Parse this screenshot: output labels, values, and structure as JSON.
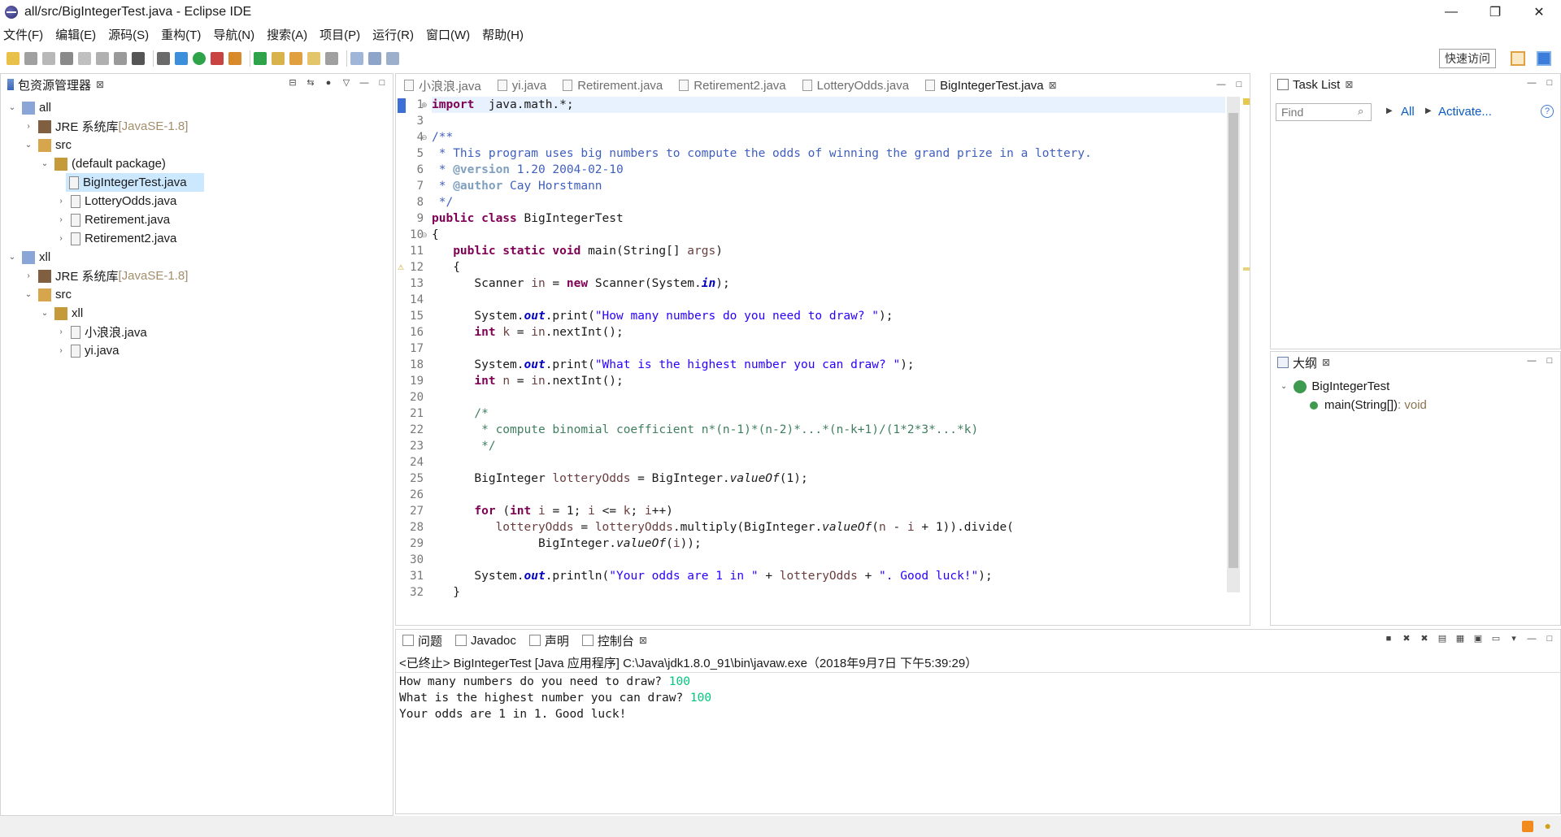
{
  "window": {
    "title": "all/src/BigIntegerTest.java - Eclipse IDE",
    "minimize": "—",
    "restore": "❐",
    "close": "✕"
  },
  "menu": [
    "文件(F)",
    "编辑(E)",
    "源码(S)",
    "重构(T)",
    "导航(N)",
    "搜索(A)",
    "项目(P)",
    "运行(R)",
    "窗口(W)",
    "帮助(H)"
  ],
  "toolbar": {
    "quick_access": "快速访问"
  },
  "package_explorer": {
    "title": "包资源管理器",
    "rows": [
      {
        "label": "all",
        "suffix": "",
        "chev": "⌄",
        "indent": 0,
        "icon": "project-icon"
      },
      {
        "label": "JRE 系统库 ",
        "suffix": "[JavaSE-1.8]",
        "chev": "›",
        "indent": 1,
        "icon": "library-icon"
      },
      {
        "label": "src",
        "suffix": "",
        "chev": "⌄",
        "indent": 1,
        "icon": "source-folder-icon"
      },
      {
        "label": "(default package)",
        "suffix": "",
        "chev": "⌄",
        "indent": 2,
        "icon": "package-icon"
      },
      {
        "label": "BigIntegerTest.java",
        "suffix": "",
        "chev": "›",
        "indent": 3,
        "icon": "java-file-icon",
        "selected": true
      },
      {
        "label": "LotteryOdds.java",
        "suffix": "",
        "chev": "›",
        "indent": 3,
        "icon": "java-file-icon"
      },
      {
        "label": "Retirement.java",
        "suffix": "",
        "chev": "›",
        "indent": 3,
        "icon": "java-file-icon"
      },
      {
        "label": "Retirement2.java",
        "suffix": "",
        "chev": "›",
        "indent": 3,
        "icon": "java-file-icon"
      },
      {
        "label": "xll",
        "suffix": "",
        "chev": "⌄",
        "indent": 0,
        "icon": "project-icon"
      },
      {
        "label": "JRE 系统库 ",
        "suffix": "[JavaSE-1.8]",
        "chev": "›",
        "indent": 1,
        "icon": "library-icon"
      },
      {
        "label": "src",
        "suffix": "",
        "chev": "⌄",
        "indent": 1,
        "icon": "source-folder-icon"
      },
      {
        "label": "xll",
        "suffix": "",
        "chev": "⌄",
        "indent": 2,
        "icon": "package-icon"
      },
      {
        "label": "小浪浪.java",
        "suffix": "",
        "chev": "›",
        "indent": 3,
        "icon": "java-file-icon"
      },
      {
        "label": "yi.java",
        "suffix": "",
        "chev": "›",
        "indent": 3,
        "icon": "java-file-icon"
      }
    ]
  },
  "editor": {
    "tabs": [
      {
        "label": "小浪浪.java",
        "active": false
      },
      {
        "label": "yi.java",
        "active": false
      },
      {
        "label": "Retirement.java",
        "active": false
      },
      {
        "label": "Retirement2.java",
        "active": false
      },
      {
        "label": "LotteryOdds.java",
        "active": false
      },
      {
        "label": "BigIntegerTest.java",
        "active": true
      }
    ],
    "line_numbers": [
      "1",
      "3",
      "4",
      "5",
      "6",
      "7",
      "8",
      "9",
      "10",
      "11",
      "12",
      "13",
      "14",
      "15",
      "16",
      "17",
      "18",
      "19",
      "20",
      "21",
      "22",
      "23",
      "24",
      "25",
      "26",
      "27",
      "28",
      "29",
      "30",
      "31",
      "32"
    ],
    "lines": [
      [
        [
          "kw",
          "import"
        ],
        [
          "",
          "  java.math.*;"
        ]
      ],
      [],
      [
        [
          "jd",
          "/**"
        ]
      ],
      [
        [
          "jd",
          " * This program uses big numbers to compute the odds of winning the grand prize in a lottery."
        ]
      ],
      [
        [
          "jd",
          " * "
        ],
        [
          "tag",
          "@version"
        ],
        [
          "jd",
          " 1.20 2004-02-10"
        ]
      ],
      [
        [
          "jd",
          " * "
        ],
        [
          "tag",
          "@author"
        ],
        [
          "jd",
          " Cay Horstmann"
        ]
      ],
      [
        [
          "jd",
          " */"
        ]
      ],
      [
        [
          "kw",
          "public class"
        ],
        [
          "",
          " BigIntegerTest"
        ]
      ],
      [
        [
          "",
          "{"
        ]
      ],
      [
        [
          "",
          "   "
        ],
        [
          "kw",
          "public static void"
        ],
        [
          "",
          " main(String[] "
        ],
        [
          "var",
          "args"
        ],
        [
          "",
          ")"
        ]
      ],
      [
        [
          "",
          "   {"
        ]
      ],
      [
        [
          "",
          "      Scanner "
        ],
        [
          "var",
          "in"
        ],
        [
          "",
          " = "
        ],
        [
          "kw",
          "new"
        ],
        [
          "",
          " Scanner(System."
        ],
        [
          "fld",
          "in"
        ],
        [
          "",
          ");"
        ]
      ],
      [],
      [
        [
          "",
          "      System."
        ],
        [
          "fld",
          "out"
        ],
        [
          "",
          ".print("
        ],
        [
          "str",
          "\"How many numbers do you need to draw? \""
        ],
        [
          "",
          ");"
        ]
      ],
      [
        [
          "",
          "      "
        ],
        [
          "kw",
          "int"
        ],
        [
          "",
          " "
        ],
        [
          "var",
          "k"
        ],
        [
          "",
          " = "
        ],
        [
          "var",
          "in"
        ],
        [
          "",
          ".nextInt();"
        ]
      ],
      [],
      [
        [
          "",
          "      System."
        ],
        [
          "fld",
          "out"
        ],
        [
          "",
          ".print("
        ],
        [
          "str",
          "\"What is the highest number you can draw? \""
        ],
        [
          "",
          ");"
        ]
      ],
      [
        [
          "",
          "      "
        ],
        [
          "kw",
          "int"
        ],
        [
          "",
          " "
        ],
        [
          "var",
          "n"
        ],
        [
          "",
          " = "
        ],
        [
          "var",
          "in"
        ],
        [
          "",
          ".nextInt();"
        ]
      ],
      [],
      [
        [
          "cm",
          "      /*"
        ]
      ],
      [
        [
          "cm",
          "       * compute binomial coefficient n*(n-1)*(n-2)*...*(n-k+1)/(1*2*3*...*k)"
        ]
      ],
      [
        [
          "cm",
          "       */"
        ]
      ],
      [],
      [
        [
          "",
          "      BigInteger "
        ],
        [
          "var",
          "lotteryOdds"
        ],
        [
          "",
          " = BigInteger."
        ],
        [
          "st-m",
          "valueOf"
        ],
        [
          "",
          "(1);"
        ]
      ],
      [],
      [
        [
          "",
          "      "
        ],
        [
          "kw",
          "for"
        ],
        [
          "",
          " ("
        ],
        [
          "kw",
          "int"
        ],
        [
          "",
          " "
        ],
        [
          "var",
          "i"
        ],
        [
          "",
          " = 1; "
        ],
        [
          "var",
          "i"
        ],
        [
          "",
          " <= "
        ],
        [
          "var",
          "k"
        ],
        [
          "",
          "; "
        ],
        [
          "var",
          "i"
        ],
        [
          "",
          "++)"
        ]
      ],
      [
        [
          "",
          "         "
        ],
        [
          "var",
          "lotteryOdds"
        ],
        [
          "",
          " = "
        ],
        [
          "var",
          "lotteryOdds"
        ],
        [
          "",
          ".multiply(BigInteger."
        ],
        [
          "st-m",
          "valueOf"
        ],
        [
          "",
          "("
        ],
        [
          "var",
          "n"
        ],
        [
          "",
          " - "
        ],
        [
          "var",
          "i"
        ],
        [
          "",
          " + 1)).divide("
        ]
      ],
      [
        [
          "",
          "               BigInteger."
        ],
        [
          "st-m",
          "valueOf"
        ],
        [
          "",
          "("
        ],
        [
          "var",
          "i"
        ],
        [
          "",
          "));"
        ]
      ],
      [],
      [
        [
          "",
          "      System."
        ],
        [
          "fld",
          "out"
        ],
        [
          "",
          ".println("
        ],
        [
          "str",
          "\"Your odds are 1 in \""
        ],
        [
          "",
          " + "
        ],
        [
          "var",
          "lotteryOdds"
        ],
        [
          "",
          " + "
        ],
        [
          "str",
          "\". Good luck!\""
        ],
        [
          "",
          ");"
        ]
      ],
      [
        [
          "",
          "   }"
        ]
      ]
    ]
  },
  "task_list": {
    "title": "Task List",
    "find_placeholder": "Find",
    "all_link": "All",
    "activate_link": "Activate..."
  },
  "outline": {
    "title": "大纲",
    "class_name": "BigIntegerTest",
    "method": "main(String[])",
    "method_type": " : void"
  },
  "bottom_tabs": [
    {
      "label": "问题",
      "icon": "problems-icon"
    },
    {
      "label": "Javadoc",
      "icon": "javadoc-icon"
    },
    {
      "label": "声明",
      "icon": "declaration-icon"
    },
    {
      "label": "控制台",
      "icon": "console-icon",
      "active": true
    }
  ],
  "console": {
    "info": "<已终止> BigIntegerTest [Java 应用程序] C:\\Java\\jdk1.8.0_91\\bin\\javaw.exe（2018年9月7日 下午5:39:29）",
    "output": [
      {
        "text": "How many numbers do you need to draw? ",
        "input": "100"
      },
      {
        "text": "What is the highest number you can draw? ",
        "input": "100"
      },
      {
        "text": "Your odds are 1 in 1. Good luck!",
        "input": ""
      }
    ]
  }
}
